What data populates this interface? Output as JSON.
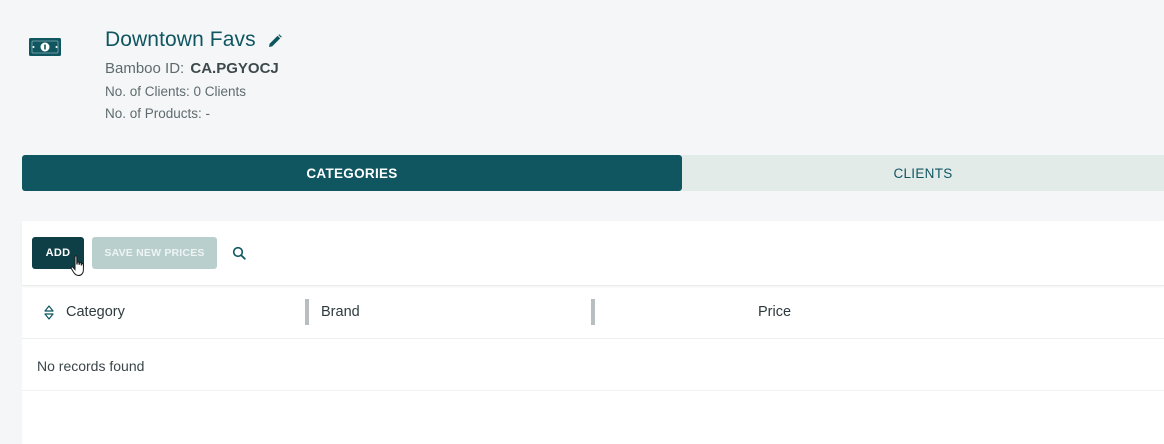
{
  "header": {
    "title": "Downtown Favs",
    "id_label": "Bamboo ID:",
    "id_value": "CA.PGYOCJ",
    "clients_line": "No. of Clients: 0 Clients",
    "products_line": "No. of Products: -"
  },
  "tabs": [
    {
      "label": "CATEGORIES",
      "active": true
    },
    {
      "label": "CLIENTS",
      "active": false
    }
  ],
  "toolbar": {
    "add_label": "ADD",
    "save_label": "SAVE NEW PRICES"
  },
  "table": {
    "columns": [
      "Category",
      "Brand",
      "Price"
    ],
    "empty_message": "No records found"
  },
  "colors": {
    "primary": "#0f5661",
    "button_dark": "#0e3f47",
    "button_disabled": "#b8cfcd",
    "tab_inactive_bg": "#e3ebe9"
  },
  "icons": [
    "money-icon",
    "edit-pencil-icon",
    "search-icon",
    "sort-icon",
    "pointer-cursor-icon"
  ]
}
